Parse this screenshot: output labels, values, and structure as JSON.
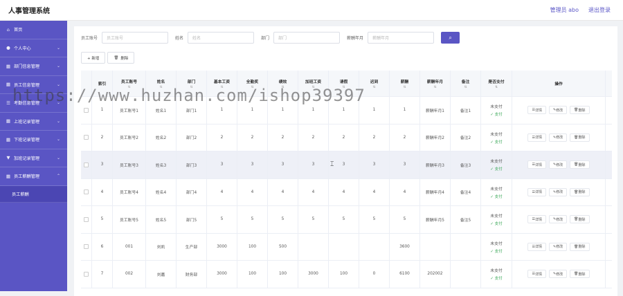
{
  "app_title": "人事管理系统",
  "top_right": {
    "user": "管理员 abo",
    "logout": "退出登录"
  },
  "sidebar": {
    "items": [
      {
        "label": "首页",
        "icon": "home-icon",
        "glyph": "⌂",
        "chevron": false
      },
      {
        "label": "个人中心",
        "icon": "user-icon",
        "glyph": "●",
        "chevron": true
      },
      {
        "label": "部门信息管理",
        "icon": "grid-icon",
        "glyph": "▦",
        "chevron": true
      },
      {
        "label": "员工信息管理",
        "icon": "grid-icon",
        "glyph": "▦",
        "chevron": true
      },
      {
        "label": "考勤信息管理",
        "icon": "list-icon",
        "glyph": "☰",
        "chevron": true
      },
      {
        "label": "上班记录管理",
        "icon": "grid-icon",
        "glyph": "▦",
        "chevron": true
      },
      {
        "label": "下班记录管理",
        "icon": "grid-icon",
        "glyph": "▦",
        "chevron": true
      },
      {
        "label": "加班记录管理",
        "icon": "filter-icon",
        "glyph": "▼",
        "chevron": true
      },
      {
        "label": "员工薪酬管理",
        "icon": "grid-icon",
        "glyph": "▦",
        "chevron": true,
        "expanded": true
      }
    ],
    "sub_item": "员工薪酬"
  },
  "search": {
    "emp_label": "员工账号",
    "emp_placeholder": "员工账号",
    "name_label": "姓名",
    "name_placeholder": "姓名",
    "dept_label": "部门",
    "dept_placeholder": "部门",
    "month_label": "薪酬年月",
    "month_placeholder": "薪酬年月"
  },
  "actions": {
    "add": "+ 新增",
    "delete": "删除"
  },
  "table": {
    "headers": [
      "索引",
      "员工账号",
      "姓名",
      "部门",
      "基本工资",
      "全勤奖",
      "绩效",
      "加班工资",
      "请假",
      "迟到",
      "薪酬",
      "薪酬年月",
      "备注",
      "是否支付",
      "操作"
    ],
    "rows": [
      [
        "1",
        "员工账号1",
        "姓名1",
        "部门1",
        "1",
        "1",
        "1",
        "1",
        "1",
        "1",
        "1",
        "薪酬年月1",
        "备注1",
        "未支付"
      ],
      [
        "2",
        "员工账号2",
        "姓名2",
        "部门2",
        "2",
        "2",
        "2",
        "2",
        "2",
        "2",
        "2",
        "薪酬年月2",
        "备注2",
        "未支付"
      ],
      [
        "3",
        "员工账号3",
        "姓名3",
        "部门3",
        "3",
        "3",
        "3",
        "3",
        "3",
        "3",
        "3",
        "薪酬年月3",
        "备注3",
        "未支付"
      ],
      [
        "4",
        "员工账号4",
        "姓名4",
        "部门4",
        "4",
        "4",
        "4",
        "4",
        "4",
        "4",
        "4",
        "薪酬年月4",
        "备注4",
        "未支付"
      ],
      [
        "5",
        "员工账号5",
        "姓名5",
        "部门5",
        "5",
        "5",
        "5",
        "5",
        "5",
        "5",
        "5",
        "薪酬年月5",
        "备注5",
        "未支付"
      ],
      [
        "6",
        "001",
        "刘凯",
        "生产部",
        "3000",
        "100",
        "500",
        "",
        "",
        "",
        "3600",
        "",
        "",
        "未支付"
      ],
      [
        "7",
        "002",
        "刘嘉",
        "财务部",
        "3000",
        "100",
        "100",
        "3000",
        "100",
        "0",
        "6100",
        "202002",
        "",
        "未支付"
      ]
    ],
    "pay_label": "支付",
    "op_detail": "详情",
    "op_edit": "修改",
    "op_delete": "删除"
  },
  "watermark": "https://www.huzhan.com/ishop39397",
  "colors": {
    "primary": "#5a55c4",
    "paid_green": "#3aa757"
  }
}
